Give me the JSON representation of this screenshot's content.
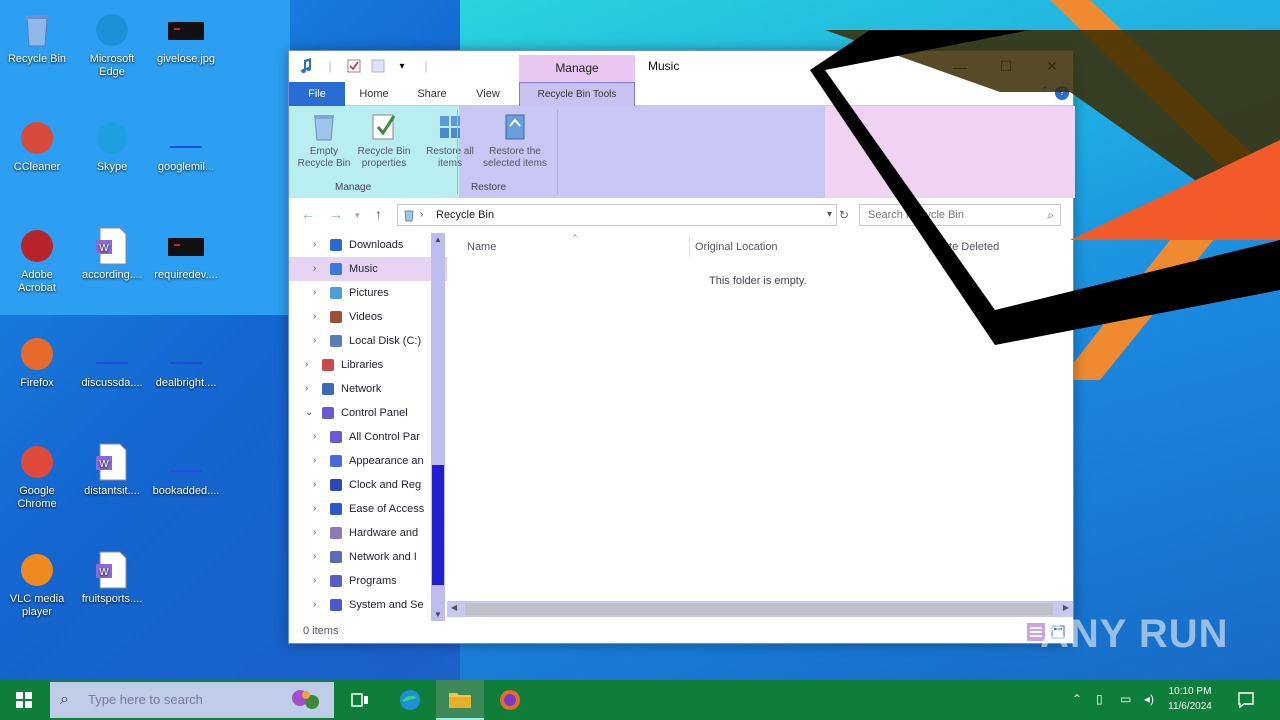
{
  "desktop": {
    "icons": [
      {
        "label": "Recycle Bin",
        "icon": "recycle-bin-icon"
      },
      {
        "label": "Microsoft Edge",
        "icon": "edge-icon"
      },
      {
        "label": "givelose.jpg",
        "icon": "image-file-icon"
      },
      {
        "label": "CCleaner",
        "icon": "ccleaner-icon"
      },
      {
        "label": "Skype",
        "icon": "skype-icon"
      },
      {
        "label": "googlemil...",
        "icon": "file-icon"
      },
      {
        "label": "Adobe Acrobat",
        "icon": "acrobat-icon"
      },
      {
        "label": "according....",
        "icon": "word-doc-icon"
      },
      {
        "label": "requiredev....",
        "icon": "image-file-icon"
      },
      {
        "label": "Firefox",
        "icon": "firefox-icon"
      },
      {
        "label": "discussda....",
        "icon": "file-icon"
      },
      {
        "label": "dealbright....",
        "icon": "file-icon"
      },
      {
        "label": "Google Chrome",
        "icon": "chrome-icon"
      },
      {
        "label": "distantsit....",
        "icon": "word-doc-icon"
      },
      {
        "label": "bookadded....",
        "icon": "file-icon"
      },
      {
        "label": "VLC media player",
        "icon": "vlc-icon"
      },
      {
        "label": "fruitsports....",
        "icon": "word-doc-icon"
      }
    ]
  },
  "window": {
    "title": "Music",
    "context_tab_group": "Manage",
    "tabs": [
      "File",
      "Home",
      "Share",
      "View",
      "Recycle Bin Tools"
    ],
    "ribbon": {
      "buttons": [
        {
          "label": "Empty Recycle Bin",
          "icon": "empty-recycle-bin-icon"
        },
        {
          "label": "Recycle Bin properties",
          "icon": "properties-icon"
        },
        {
          "label": "Restore all items",
          "icon": "restore-all-icon"
        },
        {
          "label": "Restore the selected items",
          "icon": "restore-selected-icon"
        }
      ],
      "groups": [
        "Manage",
        "Restore"
      ]
    },
    "address": {
      "path": "Recycle Bin"
    },
    "search": {
      "placeholder": "Search Recycle Bin"
    },
    "nav_items": [
      {
        "label": "Downloads",
        "icon": "downloads-icon",
        "indent": 2,
        "selected": false
      },
      {
        "label": "Music",
        "icon": "music-icon",
        "indent": 2,
        "selected": true
      },
      {
        "label": "Pictures",
        "icon": "pictures-icon",
        "indent": 2,
        "selected": false
      },
      {
        "label": "Videos",
        "icon": "videos-icon",
        "indent": 2,
        "selected": false
      },
      {
        "label": "Local Disk (C:)",
        "icon": "drive-icon",
        "indent": 2,
        "selected": false
      },
      {
        "label": "Libraries",
        "icon": "libraries-icon",
        "indent": 1,
        "selected": false
      },
      {
        "label": "Network",
        "icon": "network-icon",
        "indent": 1,
        "selected": false
      },
      {
        "label": "Control Panel",
        "icon": "control-panel-icon",
        "indent": 1,
        "selected": false,
        "expanded": true
      },
      {
        "label": "All Control Par",
        "icon": "control-panel-icon",
        "indent": 2,
        "selected": false
      },
      {
        "label": "Appearance an",
        "icon": "appearance-icon",
        "indent": 2,
        "selected": false
      },
      {
        "label": "Clock and Reg",
        "icon": "clock-icon",
        "indent": 2,
        "selected": false
      },
      {
        "label": "Ease of Access",
        "icon": "ease-of-access-icon",
        "indent": 2,
        "selected": false
      },
      {
        "label": "Hardware and",
        "icon": "hardware-icon",
        "indent": 2,
        "selected": false
      },
      {
        "label": "Network and I",
        "icon": "network-internet-icon",
        "indent": 2,
        "selected": false
      },
      {
        "label": "Programs",
        "icon": "programs-icon",
        "indent": 2,
        "selected": false
      },
      {
        "label": "System and Se",
        "icon": "system-security-icon",
        "indent": 2,
        "selected": false
      }
    ],
    "columns": [
      "Name",
      "Original Location",
      "Date Deleted"
    ],
    "empty_message": "This folder is empty.",
    "status": {
      "item_count": "0 items"
    }
  },
  "taskbar": {
    "search_placeholder": "Type here to search",
    "clock_time": "10:10 PM",
    "clock_date": "11/6/2024"
  },
  "watermark": "ANY RUN",
  "colors": {
    "taskbar": "#0f7e3b",
    "file_tab": "#2b6cd4",
    "manage_tab": "#e8c7f0"
  }
}
